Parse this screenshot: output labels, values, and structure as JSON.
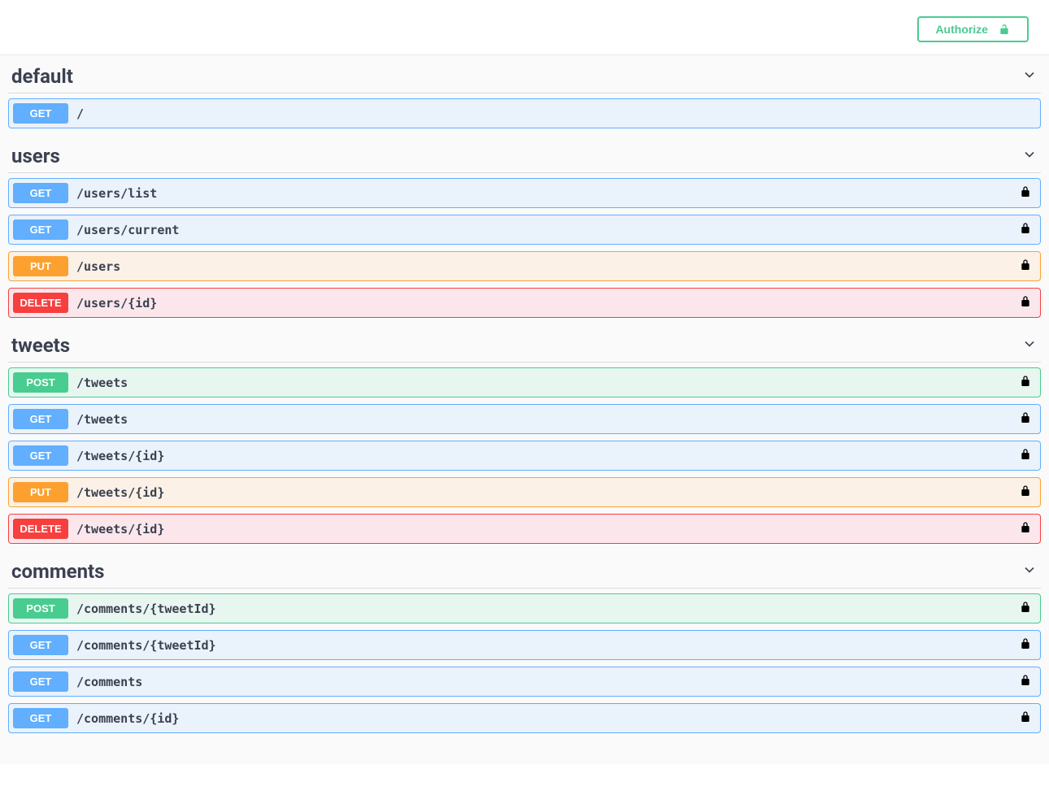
{
  "authorize_button_label": "Authorize",
  "sections": [
    {
      "name": "default",
      "ops": [
        {
          "method": "GET",
          "path": "/",
          "locked": false
        }
      ]
    },
    {
      "name": "users",
      "ops": [
        {
          "method": "GET",
          "path": "/users/list",
          "locked": true
        },
        {
          "method": "GET",
          "path": "/users/current",
          "locked": true
        },
        {
          "method": "PUT",
          "path": "/users",
          "locked": true
        },
        {
          "method": "DELETE",
          "path": "/users/{id}",
          "locked": true
        }
      ]
    },
    {
      "name": "tweets",
      "ops": [
        {
          "method": "POST",
          "path": "/tweets",
          "locked": true
        },
        {
          "method": "GET",
          "path": "/tweets",
          "locked": true
        },
        {
          "method": "GET",
          "path": "/tweets/{id}",
          "locked": true
        },
        {
          "method": "PUT",
          "path": "/tweets/{id}",
          "locked": true
        },
        {
          "method": "DELETE",
          "path": "/tweets/{id}",
          "locked": true
        }
      ]
    },
    {
      "name": "comments",
      "ops": [
        {
          "method": "POST",
          "path": "/comments/{tweetId}",
          "locked": true
        },
        {
          "method": "GET",
          "path": "/comments/{tweetId}",
          "locked": true
        },
        {
          "method": "GET",
          "path": "/comments",
          "locked": true
        },
        {
          "method": "GET",
          "path": "/comments/{id}",
          "locked": true
        }
      ]
    }
  ]
}
